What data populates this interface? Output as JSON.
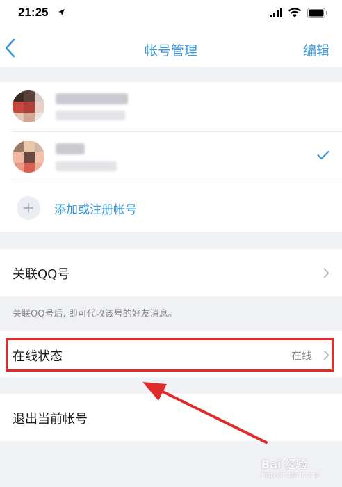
{
  "status_bar": {
    "time": "21:25"
  },
  "nav": {
    "title": "帐号管理",
    "edit_label": "编辑"
  },
  "accounts": {
    "add_label": "添加或注册帐号",
    "active_index": 1
  },
  "link_qq": {
    "label": "关联QQ号",
    "note": "关联QQ号后, 即可代收该号的好友消息。"
  },
  "online_status": {
    "label": "在线状态",
    "value": "在线"
  },
  "logout": {
    "label": "退出当前帐号"
  },
  "watermark": {
    "text": "Bai 经验",
    "sub": "jingyan.baidu.com"
  },
  "colors": {
    "accent": "#3a97d8",
    "annotation": "#e02b2b"
  }
}
